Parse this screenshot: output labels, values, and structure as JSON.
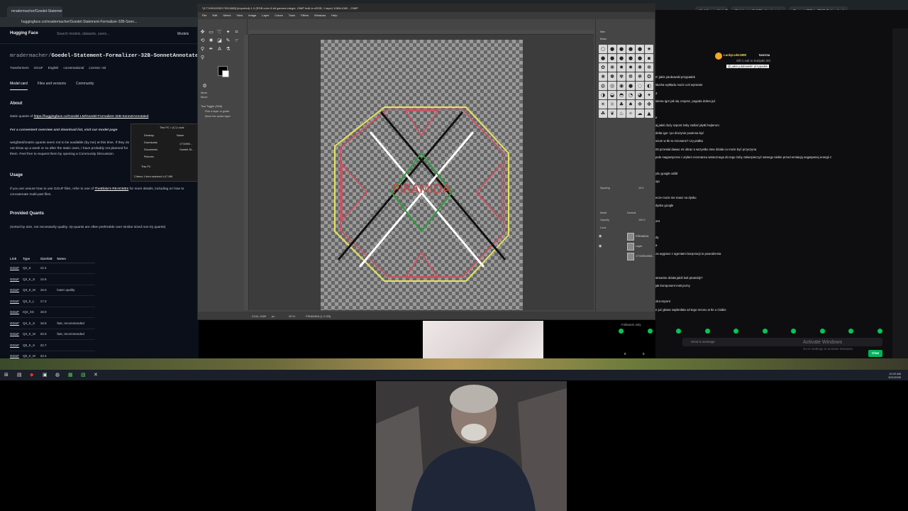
{
  "browser": {
    "tabs_left": [
      "mradermacher/Goedel-Statement-"
    ],
    "tabs_right": [
      "",
      "KickKupy - Kick Chatbird and Ch...",
      "Oidokonia (1:1/8) - live/gamin...",
      "Convert IPG to PNG Online for fr..."
    ],
    "url_left": "huggingface.co/mradermacher/Goedel-Statement-Formalizer-32B-Sonn...",
    "url_right": "kick.com"
  },
  "hf": {
    "logo": "Hugging Face",
    "search_placeholder": "Search models, datasets, users...",
    "nav_models": "Models",
    "owner": "mradermacher/",
    "repo": "Goedel-Statement-Formalizer-32B-SonnetAnnotated",
    "tags": [
      "Transformers",
      "GGUF",
      "English",
      "conversational",
      "License: mit"
    ],
    "tabs": [
      "Model card",
      "Files and versions",
      "Community"
    ],
    "files_badge": "",
    "about_heading": "About",
    "about_text_prefix": "static quants of ",
    "about_link": "https://huggingface.co/Goedel-LM/Goedel-Formalizer-32B-SonnetAnnotated",
    "overview_text": "For a convenient overview and download list, visit our model page",
    "imatrix_text": "weighted/imatrix quants seem not to be available (by me) at this time. If they do not show up a week or so after the static ones, I have probably not planned for them. Feel free to request them by opening a Community Discussion.",
    "usage_heading": "Usage",
    "usage_text_prefix": "If you are unsure how to use GGUF files, refer to one of ",
    "usage_link": "TheBloke's READMEs",
    "usage_text_suffix": " for more details, including on how to concatenate multi-part files.",
    "quants_heading": "Provided Quants",
    "quants_text": "(sorted by size, not necessarily quality. IQ-quants are often preferable over similar sized non-IQ quants)",
    "table_headers": [
      "Link",
      "Type",
      "Size/GB",
      "Notes"
    ],
    "table_rows": [
      [
        "GGUF",
        "Q2_K",
        "12.4",
        ""
      ],
      [
        "GGUF",
        "Q3_K_S",
        "14.5",
        ""
      ],
      [
        "GGUF",
        "Q3_K_M",
        "16.0",
        "lower quality"
      ],
      [
        "GGUF",
        "Q3_K_L",
        "17.3",
        ""
      ],
      [
        "GGUF",
        "IQ4_XS",
        "18.0",
        ""
      ],
      [
        "GGUF",
        "Q4_K_S",
        "18.9",
        "fast, recommended"
      ],
      [
        "GGUF",
        "Q4_K_M",
        "20.0",
        "fast, recommended"
      ],
      [
        "GGUF",
        "Q5_K_S",
        "22.7",
        ""
      ],
      [
        "GGUF",
        "Q5_K_M",
        "23.4",
        ""
      ]
    ]
  },
  "explorer": {
    "items": [
      "Desktop",
      "Downloads",
      "Documents",
      "Pictures",
      "This PC"
    ],
    "path": "This PC > (C:) Local",
    "name_header": "Name",
    "files": [
      "1774990...",
      "Goedel-St..."
    ],
    "status": "2 items   1 item selected  4.47 MB"
  },
  "gimp": {
    "title": "*[17749910053179911885] (imported)-1.0 (RGB color 8-bit gamma integer, GIMP built-in sRGB, 1 layer) 1080x1080 – GIMP",
    "menu": [
      "File",
      "Edit",
      "Select",
      "View",
      "Image",
      "Layer",
      "Colors",
      "Tools",
      "Filters",
      "Windows",
      "Help"
    ],
    "tool_options": {
      "title": "Move",
      "mode_label": "Move:",
      "toggle_label": "Tool Toggle  (Shift)",
      "opt1": "Pick a layer or guide",
      "opt2": "Move the active layer"
    },
    "image_text": "PIRAMIDA",
    "status": {
      "coords": "2134, 2459",
      "unit": "px",
      "zoom": "25 %",
      "layer": "PIRAMIDA (1.2 GB)"
    },
    "dock": {
      "filter_label": "filter",
      "basic_label": "Basic",
      "spacing_label": "Spacing",
      "spacing_value": "10.0",
      "mode_label": "Mode",
      "mode_value": "Normal",
      "opacity_label": "Opacity",
      "opacity_value": "100.0",
      "lock_label": "Lock:",
      "layers": [
        "PIRAMIDA",
        "Layer",
        "17749910053..."
      ]
    },
    "colors": {
      "dark": "#454545",
      "pyramid_red": "#d9485a",
      "pyramid_green": "#2e9b3a",
      "pyramid_yellow": "#e6e25a",
      "text_color": "#c04a4a"
    }
  },
  "chat": {
    "top_user": "LuckyLuke1980",
    "top_user2": "tworma",
    "gift_text": "Gift 1 sub to Sukiyaki 3rd",
    "reply_text": "@ jakis jutubowski przypadek",
    "messages": [
      "rt: jakis jutubowski przypadek",
      "słucha wykładu może coś wyniesie",
      "3",
      "siema Igor jak się czujesz, pogoda dobra już",
      "",
      "e",
      "aj jakiś duży szpont żeby zaślać płytki hejterom",
      "delta igor i po drużynie powinna być",
      "szum w tle to rezonans? czy prałka",
      "00 przestal dawac mi obraz a wszystko inne dziala co może być przyczyna",
      "pole magnetyczne i użyłem rezonansu wstecznego do tego żeby zabezpieczyć samego siebie przed emitacją negatywnej energii z",
      "",
      "yśu google xddd",
      "oja",
      "",
      "ecze może nie masz na dysku",
      "dysku google",
      "",
      "ont",
      "",
      "dy",
      "a",
      "za wygrasz z agentami korporacji to powodzenia",
      "",
      "",
      "streamie działa jakiś kult piramidy?",
      "jak komponent metryczny",
      "",
      "olut szpont",
      "e już głowa naplerdala od tego rezonu w tle u Clabie"
    ],
    "followers_only": "Followers only",
    "input_placeholder": "Send a message",
    "chat_button": "Chat",
    "points": "0",
    "points2": "0"
  },
  "windows": {
    "activate_title": "Activate Windows",
    "activate_sub": "Go to Settings to activate Windows.",
    "time": "10:20 AM",
    "date": "3/21/2026"
  }
}
